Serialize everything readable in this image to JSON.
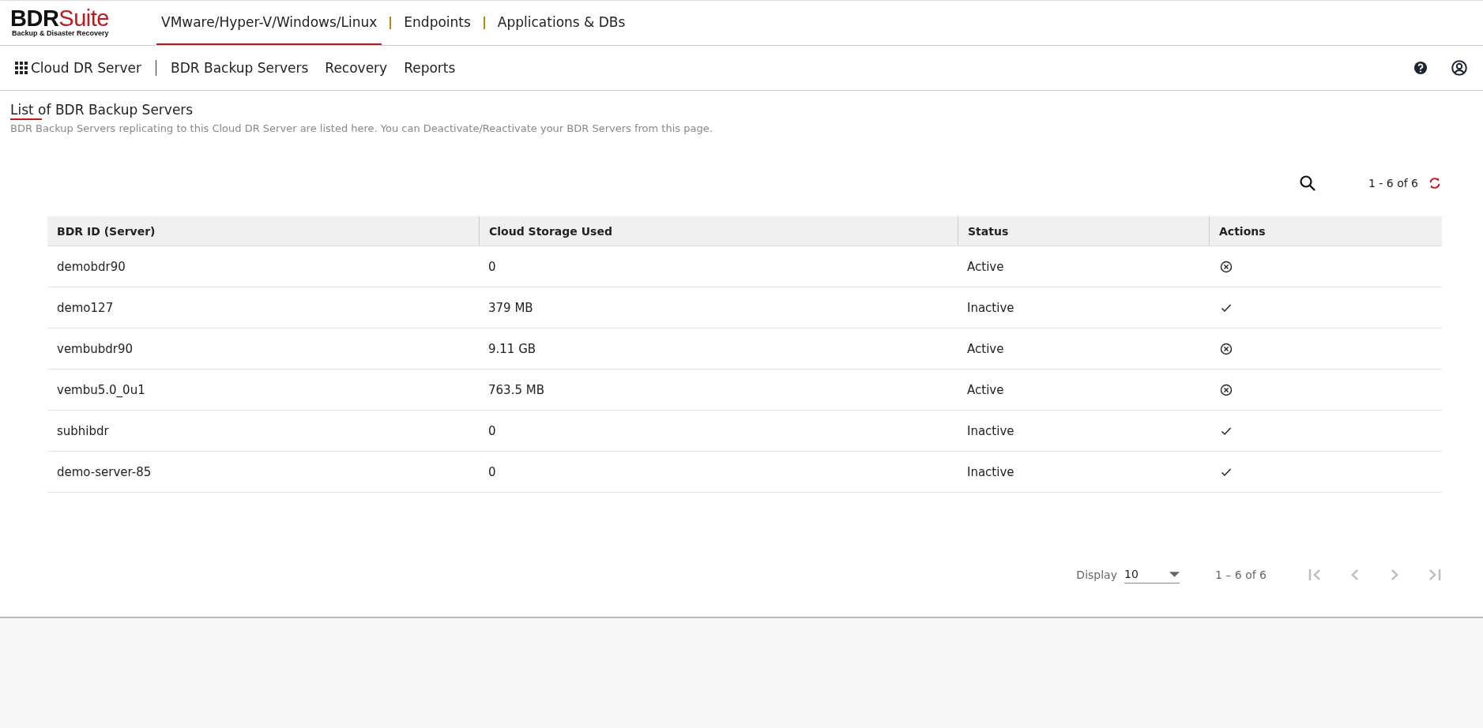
{
  "logo": {
    "brand_dark": "BDR",
    "brand_red": "Suite",
    "tagline": "Backup & Disaster Recovery"
  },
  "top_tabs": [
    {
      "label": "VMware/Hyper-V/Windows/Linux",
      "selected": true
    },
    {
      "label": "Endpoints",
      "selected": false
    },
    {
      "label": "Applications & DBs",
      "selected": false
    }
  ],
  "sub_nav": {
    "title": "Cloud DR Server",
    "items": [
      {
        "label": "BDR Backup Servers"
      },
      {
        "label": "Recovery"
      },
      {
        "label": "Reports"
      }
    ]
  },
  "page": {
    "title": "List of BDR Backup Servers",
    "description": "BDR Backup Servers replicating to this Cloud DR Server are listed here. You can Deactivate/Reactivate your BDR Servers from this page."
  },
  "toolbar": {
    "range": "1 - 6 of 6"
  },
  "table": {
    "columns": [
      "BDR ID (Server)",
      "Cloud Storage Used",
      "Status",
      "Actions"
    ],
    "rows": [
      {
        "id": "demobdr90",
        "storage": "0",
        "status": "Active",
        "kind": "deactivate"
      },
      {
        "id": "demo127",
        "storage": "379 MB",
        "status": "Inactive",
        "kind": "activate"
      },
      {
        "id": "vembubdr90",
        "storage": "9.11 GB",
        "status": "Active",
        "kind": "deactivate"
      },
      {
        "id": "vembu5.0_0u1",
        "storage": "763.5 MB",
        "status": "Active",
        "kind": "deactivate"
      },
      {
        "id": "subhibdr",
        "storage": "0",
        "status": "Inactive",
        "kind": "activate"
      },
      {
        "id": "demo-server-85",
        "storage": "0",
        "status": "Inactive",
        "kind": "activate"
      }
    ]
  },
  "paginator": {
    "display_label": "Display",
    "page_size": "10",
    "range": "1 – 6 of 6"
  }
}
